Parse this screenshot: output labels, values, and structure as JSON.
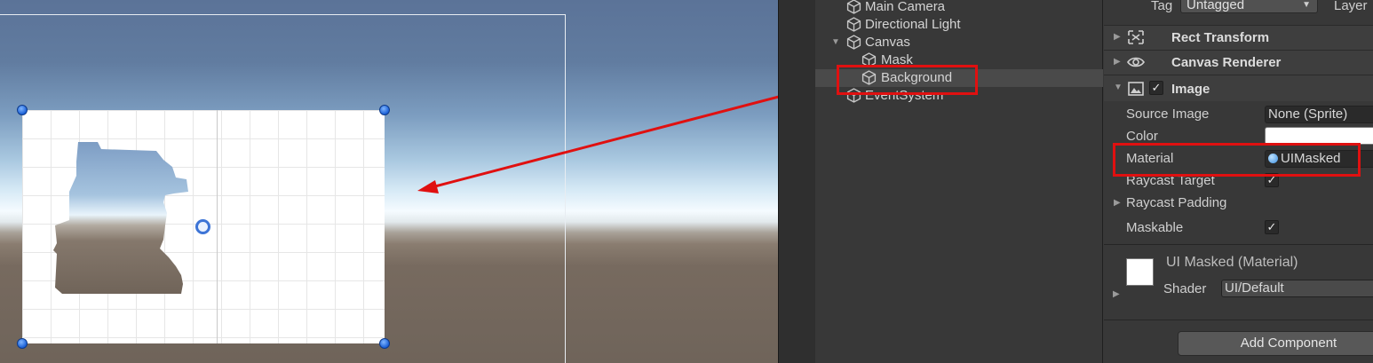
{
  "hierarchy": {
    "items": [
      {
        "label": "Main Camera"
      },
      {
        "label": "Directional Light"
      },
      {
        "label": "Canvas"
      },
      {
        "label": "Mask"
      },
      {
        "label": "Background"
      },
      {
        "label": "EventSystem"
      }
    ]
  },
  "inspector": {
    "tag_label": "Tag",
    "tag_value": "Untagged",
    "layer_label": "Layer",
    "components": {
      "rect_transform": "Rect Transform",
      "canvas_renderer": "Canvas Renderer",
      "image": "Image"
    },
    "image_props": {
      "source_image_label": "Source Image",
      "source_image_value": "None (Sprite)",
      "color_label": "Color",
      "material_label": "Material",
      "material_value": "UIMasked",
      "raycast_target_label": "Raycast Target",
      "raycast_padding_label": "Raycast Padding",
      "maskable_label": "Maskable"
    },
    "material_section": {
      "title": "UI Masked (Material)",
      "shader_label": "Shader",
      "shader_value": "UI/Default"
    },
    "add_component_label": "Add Component"
  },
  "colors": {
    "highlight_red": "#e01010",
    "scene_sky": "#5b7398",
    "panel_bg": "#383838"
  }
}
